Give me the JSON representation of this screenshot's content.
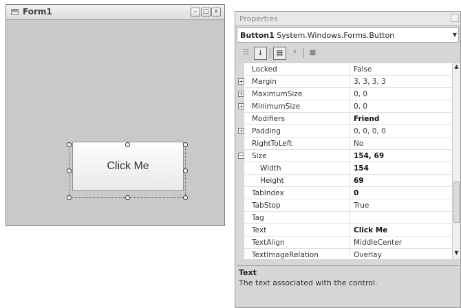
{
  "form": {
    "title": "Form1",
    "caption_buttons": {
      "minimize": "–",
      "maximize": "□",
      "close": "×"
    },
    "button_text": "Click Me"
  },
  "properties": {
    "title": "Properties",
    "object_name": "Button1",
    "object_type": "System.Windows.Forms.Button",
    "toolbar": {
      "categorized_icon": "categorized-icon",
      "alphabetical_icon": "alphabetical-icon",
      "properties_icon": "properties-icon",
      "events_icon": "events-lightning-icon",
      "property_pages_icon": "property-pages-icon"
    },
    "rows": [
      {
        "name": "Locked",
        "value": "False",
        "expander": "",
        "bold": false,
        "child": false
      },
      {
        "name": "Margin",
        "value": "3, 3, 3, 3",
        "expander": "+",
        "bold": false,
        "child": false
      },
      {
        "name": "MaximumSize",
        "value": "0, 0",
        "expander": "+",
        "bold": false,
        "child": false
      },
      {
        "name": "MinimumSize",
        "value": "0, 0",
        "expander": "+",
        "bold": false,
        "child": false
      },
      {
        "name": "Modifiers",
        "value": "Friend",
        "expander": "",
        "bold": true,
        "child": false
      },
      {
        "name": "Padding",
        "value": "0, 0, 0, 0",
        "expander": "+",
        "bold": false,
        "child": false
      },
      {
        "name": "RightToLeft",
        "value": "No",
        "expander": "",
        "bold": false,
        "child": false
      },
      {
        "name": "Size",
        "value": "154, 69",
        "expander": "−",
        "bold": true,
        "child": false
      },
      {
        "name": "Width",
        "value": "154",
        "expander": "",
        "bold": true,
        "child": true
      },
      {
        "name": "Height",
        "value": "69",
        "expander": "",
        "bold": true,
        "child": true
      },
      {
        "name": "TabIndex",
        "value": "0",
        "expander": "",
        "bold": true,
        "child": false
      },
      {
        "name": "TabStop",
        "value": "True",
        "expander": "",
        "bold": false,
        "child": false
      },
      {
        "name": "Tag",
        "value": "",
        "expander": "",
        "bold": false,
        "child": false
      },
      {
        "name": "Text",
        "value": "Click Me",
        "expander": "",
        "bold": true,
        "child": false
      },
      {
        "name": "TextAlign",
        "value": "MiddleCenter",
        "expander": "",
        "bold": false,
        "child": false
      },
      {
        "name": "TextImageRelation",
        "value": "Overlay",
        "expander": "",
        "bold": false,
        "child": false
      }
    ],
    "description": {
      "title": "Text",
      "text": "The text associated with the control."
    }
  }
}
